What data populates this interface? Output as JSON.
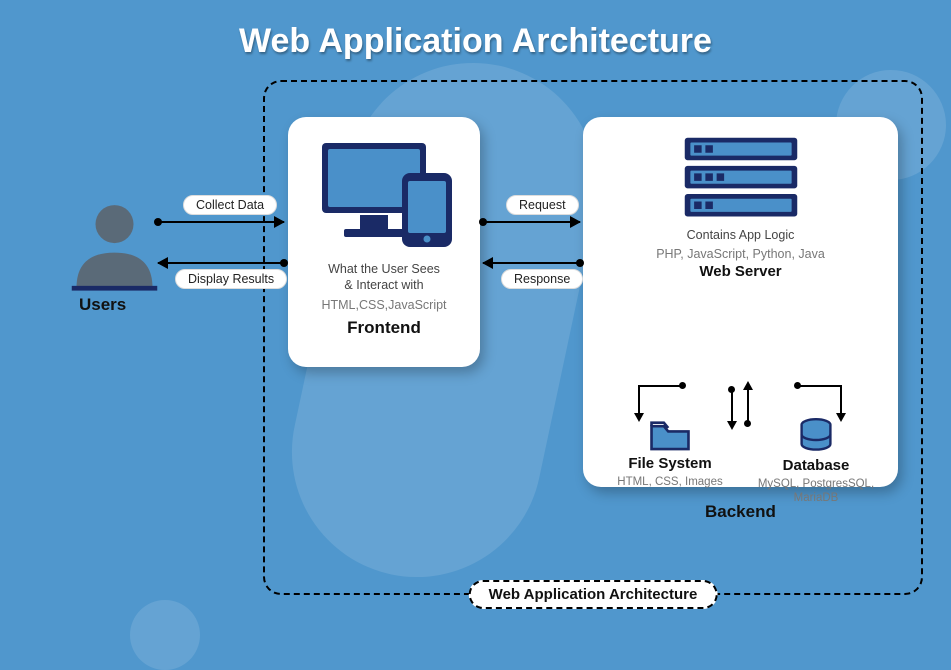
{
  "title": "Web Application Architecture",
  "users_label": "Users",
  "arrows": {
    "collect": "Collect Data",
    "display": "Display Results",
    "request": "Request",
    "response": "Response"
  },
  "frontend": {
    "subtitle1": "What the User Sees",
    "subtitle2": "& Interact with",
    "tech": "HTML,CSS,JavaScript",
    "label": "Frontend"
  },
  "backend": {
    "subtitle": "Contains App Logic",
    "tech": "PHP, JavaScript, Python, Java",
    "webserver_label": "Web Server",
    "filesystem": {
      "label": "File System",
      "tech": "HTML, CSS, Images"
    },
    "database": {
      "label": "Database",
      "tech": "MySQL, PostgresSQL, MariaDB"
    },
    "label": "Backend"
  },
  "container_label": "Web Application Architecture"
}
